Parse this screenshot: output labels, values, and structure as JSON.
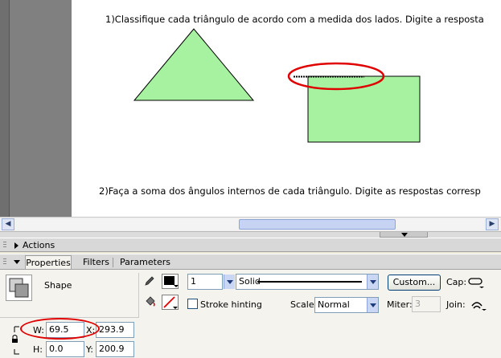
{
  "canvas": {
    "question1": "1)Classifique cada triângulo de acordo com a medida dos lados. Digite a resposta",
    "question2": "2)Faça a soma dos ângulos internos de cada triângulo. Digite as respostas corresp",
    "shape_fill": "#a6f2a1",
    "highlight_color": "#e00000"
  },
  "panels": {
    "actions": {
      "label": "Actions"
    },
    "tabs": [
      {
        "label": "Properties",
        "active": true
      },
      {
        "label": "Filters",
        "active": false
      },
      {
        "label": "Parameters",
        "active": false
      }
    ]
  },
  "properties": {
    "selection_type": "Shape",
    "stroke_height": "1",
    "stroke_style": "Solid",
    "custom_button": "Custom...",
    "cap_label": "Cap:",
    "stroke_hinting_label": "Stroke hinting",
    "stroke_hinting_checked": false,
    "scale_label": "Scale:",
    "scale_value": "Normal",
    "miter_label": "Miter:",
    "miter_value": "3",
    "join_label": "Join:",
    "w_label": "W:",
    "w_value": "69.5",
    "x_label": "X:",
    "x_value": "293.9",
    "h_label": "H:",
    "h_value": "0.0",
    "y_label": "Y:",
    "y_value": "200.9",
    "stroke_color": "#000000"
  }
}
